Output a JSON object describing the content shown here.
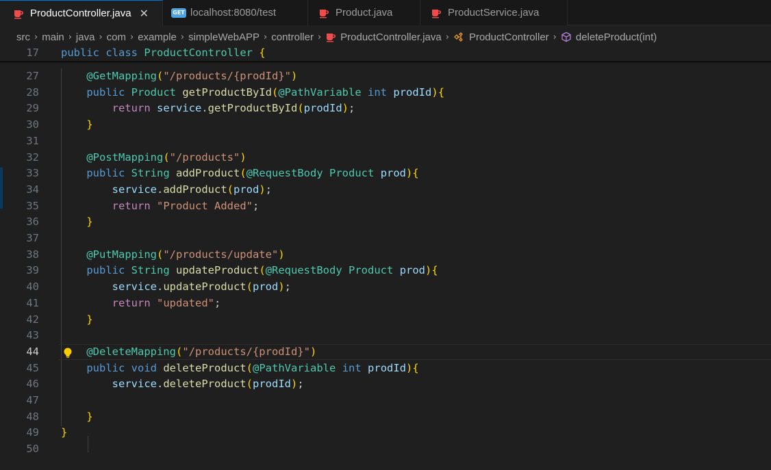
{
  "tabs": [
    {
      "label": "ProductController.java",
      "icon": "java-icon",
      "active": true,
      "close": "✕"
    },
    {
      "label": "localhost:8080/test",
      "icon": "get-request-icon",
      "badge": "GET"
    },
    {
      "label": "Product.java",
      "icon": "java-icon"
    },
    {
      "label": "ProductService.java",
      "icon": "java-icon"
    }
  ],
  "breadcrumb": [
    "src",
    "main",
    "java",
    "com",
    "example",
    "simpleWebAPP",
    "controller",
    "ProductController.java",
    "ProductController",
    "deleteProduct(int)"
  ],
  "colors": {
    "background": "#1f1f1f",
    "keyword": "#569cd6",
    "type": "#4ec9b0",
    "function": "#dcdcaa",
    "variable": "#9cdcfe",
    "string": "#ce9178",
    "java_icon": "#f14c4c",
    "lightbulb": "#ffcc00"
  },
  "lines": [
    {
      "n": "17",
      "text": "public class ProductController {"
    },
    {
      "n": "27",
      "text": "    @GetMapping(\"/products/{prodId}\")"
    },
    {
      "n": "28",
      "text": "    public Product getProductById(@PathVariable int prodId){"
    },
    {
      "n": "29",
      "text": "        return service.getProductById(prodId);"
    },
    {
      "n": "30",
      "text": "    }"
    },
    {
      "n": "31",
      "text": ""
    },
    {
      "n": "32",
      "text": "    @PostMapping(\"/products\")"
    },
    {
      "n": "33",
      "text": "    public String addProduct(@RequestBody Product prod){"
    },
    {
      "n": "34",
      "text": "        service.addProduct(prod);"
    },
    {
      "n": "35",
      "text": "        return \"Product Added\";"
    },
    {
      "n": "36",
      "text": "    }"
    },
    {
      "n": "37",
      "text": ""
    },
    {
      "n": "38",
      "text": "    @PutMapping(\"/products/update\")"
    },
    {
      "n": "39",
      "text": "    public String updateProduct(@RequestBody Product prod){"
    },
    {
      "n": "40",
      "text": "        service.updateProduct(prod);"
    },
    {
      "n": "41",
      "text": "        return \"updated\";"
    },
    {
      "n": "42",
      "text": "    }"
    },
    {
      "n": "43",
      "text": ""
    },
    {
      "n": "44",
      "text": "    @DeleteMapping(\"/products/{prodId}\")",
      "active": true
    },
    {
      "n": "45",
      "text": "    public void deleteProduct(@PathVariable int prodId){"
    },
    {
      "n": "46",
      "text": "        service.deleteProduct(prodId);"
    },
    {
      "n": "47",
      "text": ""
    },
    {
      "n": "48",
      "text": "    }"
    },
    {
      "n": "49",
      "text": "}"
    },
    {
      "n": "50",
      "text": ""
    }
  ]
}
